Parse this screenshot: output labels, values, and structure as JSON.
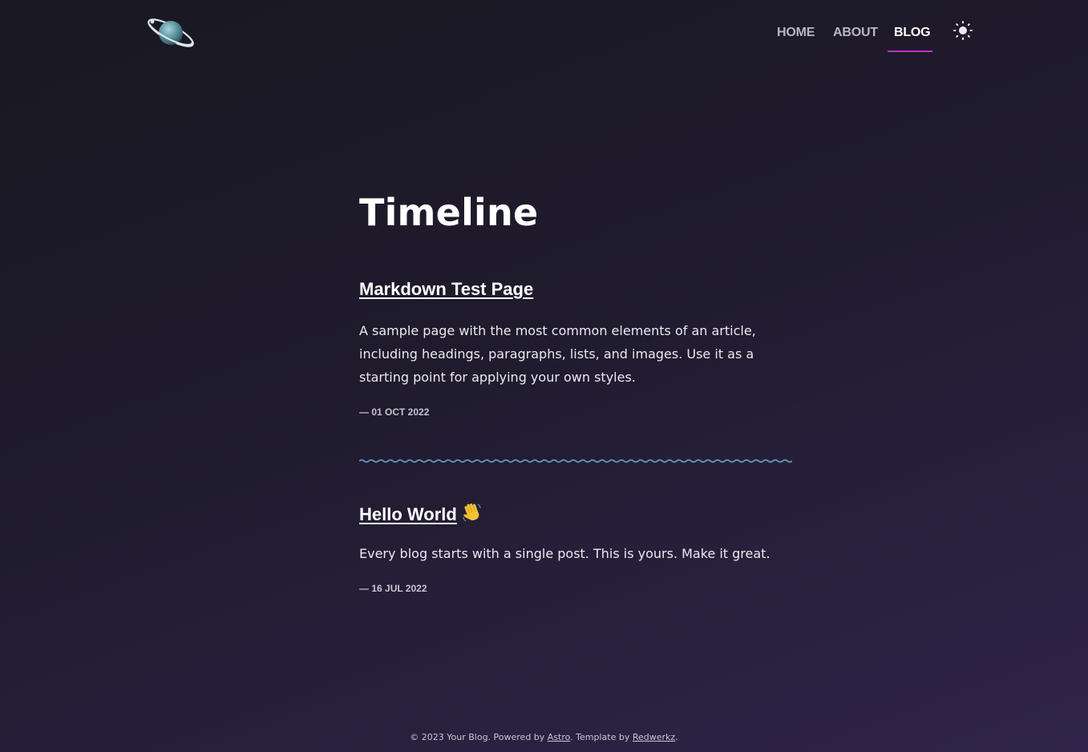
{
  "nav": {
    "items": [
      {
        "label": "HOME"
      },
      {
        "label": "ABOUT"
      },
      {
        "label": "BLOG"
      }
    ],
    "active": "BLOG",
    "accent_color": "#c430c4"
  },
  "icons": {
    "logo": "planet-logo-icon",
    "theme": "sun-icon"
  },
  "page": {
    "title": "Timeline"
  },
  "posts": [
    {
      "title": "Markdown Test Page",
      "description": "A sample page with the most common elements of an article, including headings, paragraphs, lists, and images. Use it as a starting point for applying your own styles.",
      "date": "— 01 OCT 2022"
    },
    {
      "title": "Hello World",
      "emoji": "waving-hand-icon",
      "description": "Every blog starts with a single post. This is yours. Make it great.",
      "date": "— 16 JUL 2022"
    }
  ],
  "footer": {
    "prefix": "© 2023 Your Blog. Powered by",
    "link1": "Astro",
    "middle": ". Template by",
    "link2": "Redwerkz",
    "suffix": "."
  },
  "colors": {
    "background_start": "#1a1824",
    "background_end": "#30244a",
    "divider": "#5e8fb0"
  }
}
